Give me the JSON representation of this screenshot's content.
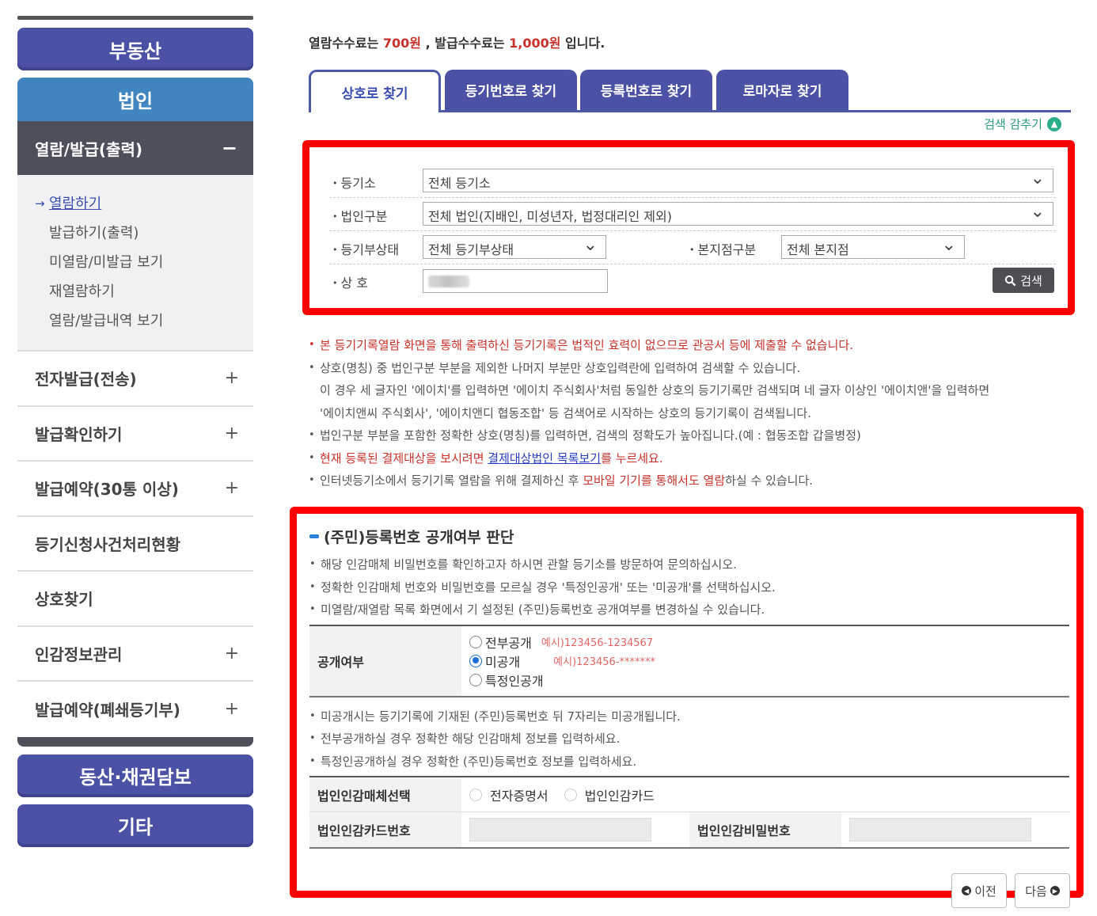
{
  "sidebar": {
    "categories": {
      "real_estate": "부동산",
      "corporation": "법인",
      "movables": "동산·채권담보",
      "etc": "기타"
    },
    "open_menu": {
      "label": "열람/발급(출력)",
      "sign": "−"
    },
    "submenu": [
      "열람하기",
      "발급하기(출력)",
      "미열람/미발급 보기",
      "재열람하기",
      "열람/발급내역 보기"
    ],
    "submenu_arrow": "→",
    "items": [
      {
        "label": "전자발급(전송)",
        "sign": "+"
      },
      {
        "label": "발급확인하기",
        "sign": "+"
      },
      {
        "label": "발급예약(30통 이상)",
        "sign": "+"
      },
      {
        "label": "등기신청사건처리현황",
        "sign": ""
      },
      {
        "label": "상호찾기",
        "sign": ""
      },
      {
        "label": "인감정보관리",
        "sign": "+"
      },
      {
        "label": "발급예약(폐쇄등기부)",
        "sign": "+"
      }
    ]
  },
  "fee": {
    "pre": "열람수수료는 ",
    "view_fee": "700원",
    "mid": " , 발급수수료는 ",
    "issue_fee": "1,000원",
    "post": " 입니다."
  },
  "tabs": [
    "상호로 찾기",
    "등기번호로 찾기",
    "등록번호로 찾기",
    "로마자로 찾기"
  ],
  "toggle_search": {
    "label": "검색 감추기",
    "icon": "▲"
  },
  "search": {
    "registry_label": "등기소",
    "registry_value": "전체 등기소",
    "corp_type_label": "법인구분",
    "corp_type_value": "전체 법인(지배인, 미성년자, 법정대리인 제외)",
    "status_label": "등기부상태",
    "status_value": "전체 등기부상태",
    "branch_label": "본지점구분",
    "branch_value": "전체 본지점",
    "name_label": "상 호",
    "button": "검색"
  },
  "notes": {
    "n1": "본 등기기록열람 화면을 통해 출력하신 등기기록은 법적인 효력이 없으므로 관공서 등에 제출할 수 없습니다.",
    "n2a": "상호(명칭) 중 법인구분 부분을 제외한 나머지 부분만 상호입력란에 입력하여 검색할 수 있습니다.",
    "n2b": "이 경우 세 글자인 '에이치'를 입력하면 '에이치 주식회사'처럼 동일한 상호의 등기기록만 검색되며 네 글자 이상인 '에이치앤'을 입력하면",
    "n2c": "'에이치앤씨 주식회사', '에이치앤디 협동조합' 등 검색어로 시작하는 상호의 등기기록이 검색됩니다.",
    "n3": "법인구분 부분을 포함한 정확한 상호(명칭)를 입력하면, 검색의 정확도가 높아집니다.(예 : 협동조합 갑을병정)",
    "n4_pre": "현재 등록된 결제대상을 보시려면 ",
    "n4_link": "결제대상법인 목록보기",
    "n4_post": "를 누르세요.",
    "n5_pre": "인터넷등기소에서 등기기록 열람을 위해 결제하신 후 ",
    "n5_red": "모바일 기기를 통해서도 열람",
    "n5_post": "하실 수 있습니다."
  },
  "reg": {
    "title": "(주민)등록번호 공개여부 판단",
    "notes": [
      "해당 인감매체 비밀번호를 확인하고자 하시면 관할 등기소를 방문하여 문의하십시오.",
      "정확한 인감매체 번호와 비밀번호를 모르실 경우 '특정인공개' 또는 '미공개'를 선택하십시오.",
      "미열람/재열람 목록 화면에서 기 설정된 (주민)등록번호 공개여부를 변경하실 수 있습니다."
    ],
    "disclosure_label": "공개여부",
    "options": [
      {
        "label": "전부공개",
        "example": "예시)123456-1234567",
        "selected": false
      },
      {
        "label": "미공개",
        "example": "예시)123456-*******",
        "selected": true
      },
      {
        "label": "특정인공개",
        "example": "",
        "selected": false
      }
    ],
    "notes2": [
      "미공개시는 등기기록에 기재된 (주민)등록번호 뒤 7자리는 미공개됩니다.",
      "전부공개하실 경우 정확한 해당 인감매체 정보를 입력하세요.",
      "특정인공개하실 경우 정확한 (주민)등록번호 정보를 입력하세요."
    ],
    "media_label": "법인인감매체선택",
    "media_options": [
      "전자증명서",
      "법인인감카드"
    ],
    "card_no_label": "법인인감카드번호",
    "card_pw_label": "법인인감비밀번호",
    "prev": "이전",
    "next": "다음"
  }
}
